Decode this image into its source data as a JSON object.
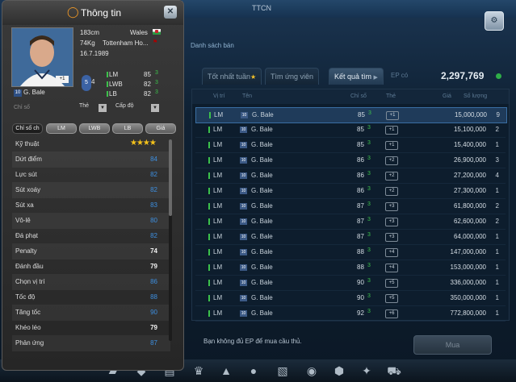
{
  "window": {
    "title": "TTCN",
    "nav_label": "Danh sách bán"
  },
  "market": {
    "tabs": [
      {
        "label": "Tốt nhất tuần"
      },
      {
        "label": "Tìm ứng viên"
      },
      {
        "label": "Kết quả tìm"
      },
      {
        "label": "EP có"
      }
    ],
    "ep_value": "2,297,769",
    "columns": [
      "Vị trí",
      "Tên",
      "Chỉ số",
      "Thẻ",
      "Giá",
      "Số lượng"
    ],
    "rows": [
      {
        "pos": "LM",
        "num": "10",
        "name": "G. Bale",
        "ovr": "85",
        "level": "+1",
        "price": "15,000,000",
        "qty": "9"
      },
      {
        "pos": "LM",
        "num": "10",
        "name": "G. Bale",
        "ovr": "85",
        "level": "+1",
        "price": "15,100,000",
        "qty": "2"
      },
      {
        "pos": "LM",
        "num": "10",
        "name": "G. Bale",
        "ovr": "85",
        "level": "+1",
        "price": "15,400,000",
        "qty": "1"
      },
      {
        "pos": "LM",
        "num": "10",
        "name": "G. Bale",
        "ovr": "86",
        "level": "+2",
        "price": "26,900,000",
        "qty": "3"
      },
      {
        "pos": "LM",
        "num": "10",
        "name": "G. Bale",
        "ovr": "86",
        "level": "+2",
        "price": "27,200,000",
        "qty": "4"
      },
      {
        "pos": "LM",
        "num": "10",
        "name": "G. Bale",
        "ovr": "86",
        "level": "+2",
        "price": "27,300,000",
        "qty": "1"
      },
      {
        "pos": "LM",
        "num": "10",
        "name": "G. Bale",
        "ovr": "87",
        "level": "+3",
        "price": "61,800,000",
        "qty": "2"
      },
      {
        "pos": "LM",
        "num": "10",
        "name": "G. Bale",
        "ovr": "87",
        "level": "+3",
        "price": "62,600,000",
        "qty": "2"
      },
      {
        "pos": "LM",
        "num": "10",
        "name": "G. Bale",
        "ovr": "87",
        "level": "+3",
        "price": "64,000,000",
        "qty": "1"
      },
      {
        "pos": "LM",
        "num": "10",
        "name": "G. Bale",
        "ovr": "88",
        "level": "+4",
        "price": "147,000,000",
        "qty": "1"
      },
      {
        "pos": "LM",
        "num": "10",
        "name": "G. Bale",
        "ovr": "88",
        "level": "+4",
        "price": "153,000,000",
        "qty": "1"
      },
      {
        "pos": "LM",
        "num": "10",
        "name": "G. Bale",
        "ovr": "90",
        "level": "+5",
        "price": "336,000,000",
        "qty": "1"
      },
      {
        "pos": "LM",
        "num": "10",
        "name": "G. Bale",
        "ovr": "90",
        "level": "+5",
        "price": "350,000,000",
        "qty": "1"
      },
      {
        "pos": "LM",
        "num": "10",
        "name": "G. Bale",
        "ovr": "92",
        "level": "+6",
        "price": "772,800,000",
        "qty": "1"
      }
    ],
    "message": "Bạn không đủ EP để mua cầu thủ.",
    "buy_label": "Mua"
  },
  "popup": {
    "title": "Thông tin",
    "close_label": "✕",
    "photo_badge": "+1",
    "shirt_number": "10",
    "player_name": "G. Bale",
    "height": "183cm",
    "nation": "Wales",
    "weight": "74Kg",
    "club": "Tottenham Ho...",
    "dob": "16.7.1989",
    "skill_moves": "5",
    "weak_foot": "4",
    "positions": [
      {
        "pos": "LM",
        "ovr": "85"
      },
      {
        "pos": "LWB",
        "ovr": "82"
      },
      {
        "pos": "LB",
        "ovr": "82"
      }
    ],
    "filter_label": "Chỉ số",
    "select_card": "Thẻ",
    "select_level": "Cấp độ",
    "subtabs": [
      "Chỉ số ch",
      "LM",
      "LWB",
      "LB",
      "Giá"
    ],
    "stats": [
      {
        "name": "Kỹ thuật",
        "value": "★★★★",
        "kind": "stars"
      },
      {
        "name": "Dứt điểm",
        "value": "84",
        "kind": "blue"
      },
      {
        "name": "Lực sút",
        "value": "82",
        "kind": "blue"
      },
      {
        "name": "Sút xoáy",
        "value": "82",
        "kind": "blue"
      },
      {
        "name": "Sút xa",
        "value": "83",
        "kind": "blue"
      },
      {
        "name": "Vô-lê",
        "value": "80",
        "kind": "blue"
      },
      {
        "name": "Đá phạt",
        "value": "82",
        "kind": "blue"
      },
      {
        "name": "Penalty",
        "value": "74",
        "kind": "white"
      },
      {
        "name": "Đánh đầu",
        "value": "79",
        "kind": "white"
      },
      {
        "name": "Chọn vị trí",
        "value": "86",
        "kind": "blue"
      },
      {
        "name": "Tốc độ",
        "value": "88",
        "kind": "blue"
      },
      {
        "name": "Tăng tốc",
        "value": "90",
        "kind": "blue"
      },
      {
        "name": "Khéo léo",
        "value": "79",
        "kind": "white"
      },
      {
        "name": "Phản ứng",
        "value": "87",
        "kind": "blue"
      }
    ]
  }
}
